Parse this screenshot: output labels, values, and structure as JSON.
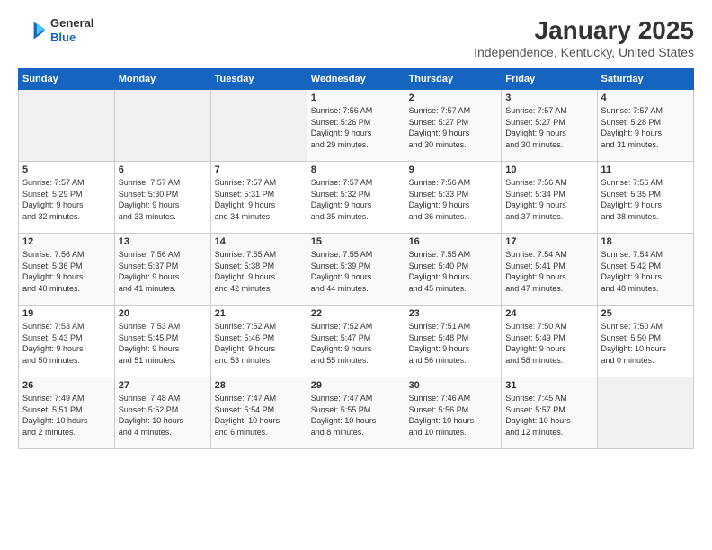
{
  "header": {
    "logo": {
      "general": "General",
      "blue": "Blue"
    },
    "title": "January 2025",
    "subtitle": "Independence, Kentucky, United States"
  },
  "calendar": {
    "weekdays": [
      "Sunday",
      "Monday",
      "Tuesday",
      "Wednesday",
      "Thursday",
      "Friday",
      "Saturday"
    ],
    "weeks": [
      [
        {
          "day": "",
          "info": ""
        },
        {
          "day": "",
          "info": ""
        },
        {
          "day": "",
          "info": ""
        },
        {
          "day": "1",
          "info": "Sunrise: 7:56 AM\nSunset: 5:26 PM\nDaylight: 9 hours\nand 29 minutes."
        },
        {
          "day": "2",
          "info": "Sunrise: 7:57 AM\nSunset: 5:27 PM\nDaylight: 9 hours\nand 30 minutes."
        },
        {
          "day": "3",
          "info": "Sunrise: 7:57 AM\nSunset: 5:27 PM\nDaylight: 9 hours\nand 30 minutes."
        },
        {
          "day": "4",
          "info": "Sunrise: 7:57 AM\nSunset: 5:28 PM\nDaylight: 9 hours\nand 31 minutes."
        }
      ],
      [
        {
          "day": "5",
          "info": "Sunrise: 7:57 AM\nSunset: 5:29 PM\nDaylight: 9 hours\nand 32 minutes."
        },
        {
          "day": "6",
          "info": "Sunrise: 7:57 AM\nSunset: 5:30 PM\nDaylight: 9 hours\nand 33 minutes."
        },
        {
          "day": "7",
          "info": "Sunrise: 7:57 AM\nSunset: 5:31 PM\nDaylight: 9 hours\nand 34 minutes."
        },
        {
          "day": "8",
          "info": "Sunrise: 7:57 AM\nSunset: 5:32 PM\nDaylight: 9 hours\nand 35 minutes."
        },
        {
          "day": "9",
          "info": "Sunrise: 7:56 AM\nSunset: 5:33 PM\nDaylight: 9 hours\nand 36 minutes."
        },
        {
          "day": "10",
          "info": "Sunrise: 7:56 AM\nSunset: 5:34 PM\nDaylight: 9 hours\nand 37 minutes."
        },
        {
          "day": "11",
          "info": "Sunrise: 7:56 AM\nSunset: 5:35 PM\nDaylight: 9 hours\nand 38 minutes."
        }
      ],
      [
        {
          "day": "12",
          "info": "Sunrise: 7:56 AM\nSunset: 5:36 PM\nDaylight: 9 hours\nand 40 minutes."
        },
        {
          "day": "13",
          "info": "Sunrise: 7:56 AM\nSunset: 5:37 PM\nDaylight: 9 hours\nand 41 minutes."
        },
        {
          "day": "14",
          "info": "Sunrise: 7:55 AM\nSunset: 5:38 PM\nDaylight: 9 hours\nand 42 minutes."
        },
        {
          "day": "15",
          "info": "Sunrise: 7:55 AM\nSunset: 5:39 PM\nDaylight: 9 hours\nand 44 minutes."
        },
        {
          "day": "16",
          "info": "Sunrise: 7:55 AM\nSunset: 5:40 PM\nDaylight: 9 hours\nand 45 minutes."
        },
        {
          "day": "17",
          "info": "Sunrise: 7:54 AM\nSunset: 5:41 PM\nDaylight: 9 hours\nand 47 minutes."
        },
        {
          "day": "18",
          "info": "Sunrise: 7:54 AM\nSunset: 5:42 PM\nDaylight: 9 hours\nand 48 minutes."
        }
      ],
      [
        {
          "day": "19",
          "info": "Sunrise: 7:53 AM\nSunset: 5:43 PM\nDaylight: 9 hours\nand 50 minutes."
        },
        {
          "day": "20",
          "info": "Sunrise: 7:53 AM\nSunset: 5:45 PM\nDaylight: 9 hours\nand 51 minutes."
        },
        {
          "day": "21",
          "info": "Sunrise: 7:52 AM\nSunset: 5:46 PM\nDaylight: 9 hours\nand 53 minutes."
        },
        {
          "day": "22",
          "info": "Sunrise: 7:52 AM\nSunset: 5:47 PM\nDaylight: 9 hours\nand 55 minutes."
        },
        {
          "day": "23",
          "info": "Sunrise: 7:51 AM\nSunset: 5:48 PM\nDaylight: 9 hours\nand 56 minutes."
        },
        {
          "day": "24",
          "info": "Sunrise: 7:50 AM\nSunset: 5:49 PM\nDaylight: 9 hours\nand 58 minutes."
        },
        {
          "day": "25",
          "info": "Sunrise: 7:50 AM\nSunset: 5:50 PM\nDaylight: 10 hours\nand 0 minutes."
        }
      ],
      [
        {
          "day": "26",
          "info": "Sunrise: 7:49 AM\nSunset: 5:51 PM\nDaylight: 10 hours\nand 2 minutes."
        },
        {
          "day": "27",
          "info": "Sunrise: 7:48 AM\nSunset: 5:52 PM\nDaylight: 10 hours\nand 4 minutes."
        },
        {
          "day": "28",
          "info": "Sunrise: 7:47 AM\nSunset: 5:54 PM\nDaylight: 10 hours\nand 6 minutes."
        },
        {
          "day": "29",
          "info": "Sunrise: 7:47 AM\nSunset: 5:55 PM\nDaylight: 10 hours\nand 8 minutes."
        },
        {
          "day": "30",
          "info": "Sunrise: 7:46 AM\nSunset: 5:56 PM\nDaylight: 10 hours\nand 10 minutes."
        },
        {
          "day": "31",
          "info": "Sunrise: 7:45 AM\nSunset: 5:57 PM\nDaylight: 10 hours\nand 12 minutes."
        },
        {
          "day": "",
          "info": ""
        }
      ]
    ]
  }
}
